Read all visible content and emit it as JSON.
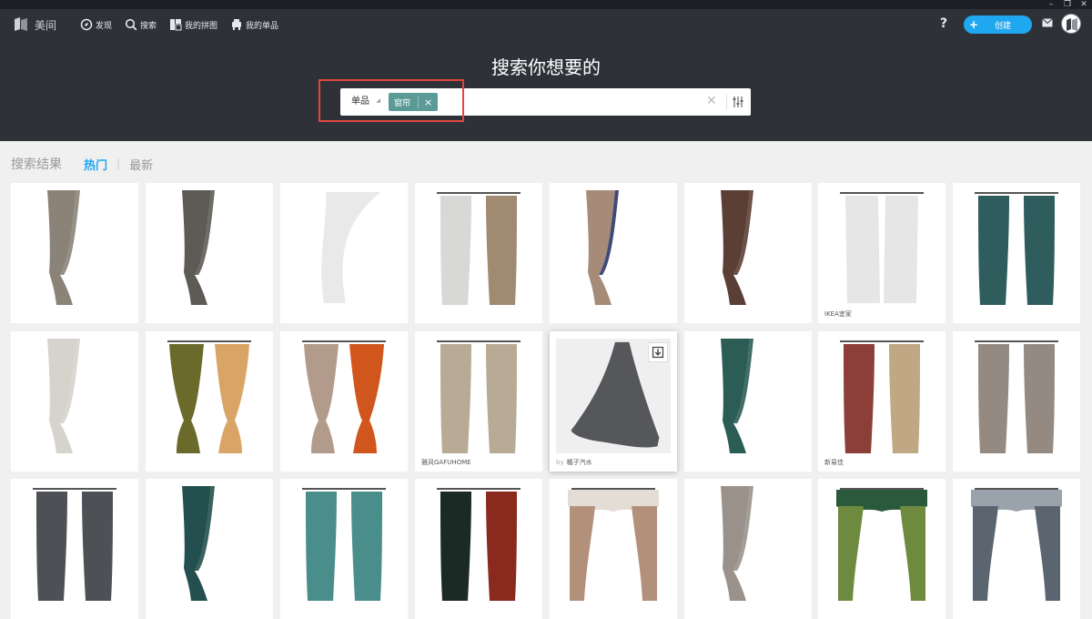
{
  "window": {
    "minimize": "–",
    "restore": "❐",
    "close": "✕"
  },
  "header": {
    "logo_text": "美间",
    "nav": [
      {
        "label": "发现",
        "icon": "compass-icon"
      },
      {
        "label": "搜索",
        "icon": "search-icon"
      },
      {
        "label": "我的拼图",
        "icon": "collage-icon"
      },
      {
        "label": "我的单品",
        "icon": "item-icon"
      }
    ],
    "help": "?",
    "create_plus": "+",
    "create_label": "创建"
  },
  "search": {
    "title": "搜索你想要的",
    "type": "单品",
    "tag": "窗帘",
    "tag_close": "×",
    "clear": "✕"
  },
  "results": {
    "title": "搜索结果",
    "tab_hot": "热门",
    "tab_sep": "|",
    "tab_new": "最新",
    "cards": [
      {
        "caption": "",
        "style": "drape",
        "colors": [
          "#8b8378"
        ]
      },
      {
        "caption": "",
        "style": "drape",
        "colors": [
          "#5e5a55"
        ]
      },
      {
        "caption": "",
        "style": "sheer",
        "colors": [
          "#e9e9e9"
        ]
      },
      {
        "caption": "",
        "style": "pair",
        "colors": [
          "#d8d8d6",
          "#a08a72"
        ]
      },
      {
        "caption": "",
        "style": "drape",
        "colors": [
          "#a58b78",
          "#2c3568"
        ]
      },
      {
        "caption": "",
        "style": "drape",
        "colors": [
          "#5c3f34"
        ]
      },
      {
        "caption": "IKEA宜家",
        "style": "sheerpair",
        "colors": [
          "#e6e6e6"
        ]
      },
      {
        "caption": "",
        "style": "pair",
        "colors": [
          "#2f5d5e"
        ]
      },
      {
        "caption": "",
        "style": "drape",
        "colors": [
          "#d6d2cc"
        ]
      },
      {
        "caption": "",
        "style": "tiedpair",
        "colors": [
          "#6b6a2a",
          "#d9a566"
        ]
      },
      {
        "caption": "",
        "style": "tiedpair",
        "colors": [
          "#b39b8c",
          "#d0561d"
        ]
      },
      {
        "caption": "雅风GAFUHOME",
        "style": "pair",
        "colors": [
          "#b8ab96"
        ]
      },
      {
        "caption": "橘子汽水",
        "by": "by",
        "style": "featured",
        "colors": [
          "#55575a"
        ]
      },
      {
        "caption": "",
        "style": "drape",
        "colors": [
          "#2c5d55"
        ]
      },
      {
        "caption": "新易佳",
        "style": "pair",
        "colors": [
          "#8c3f38",
          "#c0a884"
        ]
      },
      {
        "caption": "",
        "style": "pair",
        "colors": [
          "#948a82"
        ]
      },
      {
        "caption": "",
        "style": "pair",
        "colors": [
          "#4d5156"
        ]
      },
      {
        "caption": "",
        "style": "drape",
        "colors": [
          "#23504f"
        ]
      },
      {
        "caption": "",
        "style": "pair",
        "colors": [
          "#4a8e8c"
        ]
      },
      {
        "caption": "",
        "style": "pair",
        "colors": [
          "#1c2a25",
          "#8a2a1f"
        ]
      },
      {
        "caption": "",
        "style": "valance",
        "colors": [
          "#b3907a",
          "#e4ddd5"
        ]
      },
      {
        "caption": "",
        "style": "drape",
        "colors": [
          "#9a928a"
        ]
      },
      {
        "caption": "",
        "style": "valance",
        "colors": [
          "#6d8a3e",
          "#2a5a3b"
        ]
      },
      {
        "caption": "",
        "style": "valance",
        "colors": [
          "#5b6570",
          "#9aa3ac"
        ]
      }
    ]
  }
}
